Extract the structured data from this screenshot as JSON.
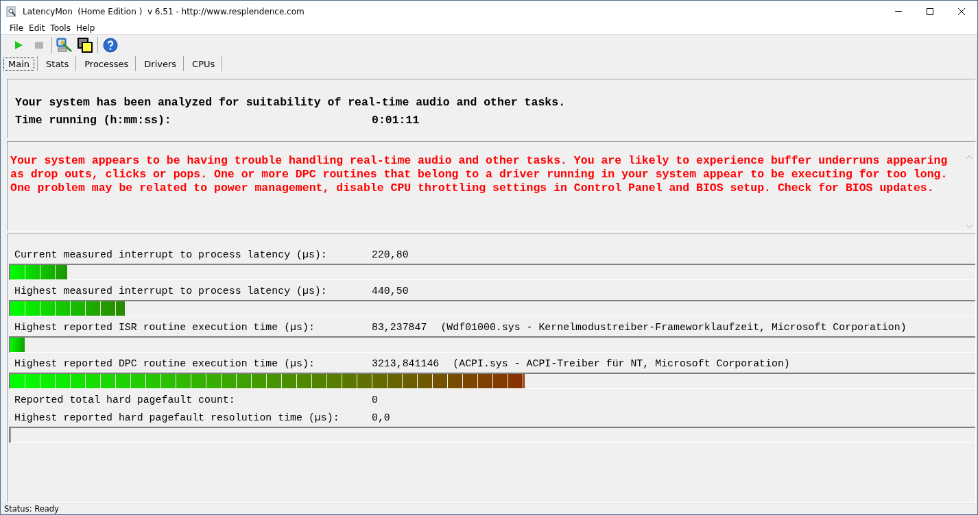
{
  "window": {
    "title": "LatencyMon  (Home Edition )  v 6.51 - http://www.resplendence.com"
  },
  "menu": [
    "File",
    "Edit",
    "Tools",
    "Help"
  ],
  "toolbar": [
    {
      "kind": "start",
      "disabled": false
    },
    {
      "kind": "stop",
      "disabled": true
    },
    {
      "kind": "separator"
    },
    {
      "kind": "monitor"
    },
    {
      "kind": "windows"
    },
    {
      "kind": "separator"
    },
    {
      "kind": "help"
    }
  ],
  "tabs": [
    {
      "label": "Main",
      "selected": true
    },
    {
      "label": "Stats",
      "selected": false
    },
    {
      "label": "Processes",
      "selected": false
    },
    {
      "label": "Drivers",
      "selected": false
    },
    {
      "label": "CPUs",
      "selected": false
    }
  ],
  "summary": {
    "text": "Your system has been analyzed for suitability of real-time audio and other tasks.",
    "time_label": "Time running (h:mm:ss):",
    "time_value": "0:01:11"
  },
  "verdict": {
    "text": "Your system appears to be having trouble handling real-time audio and other tasks. You are likely to experience buffer underruns appearing as drop outs, clicks or pops. One or more DPC routines that belong to a driver running in your system appear to be executing for too long. One problem may be related to power management, disable CPU throttling settings in Control Panel and BIOS setup. Check for BIOS updates."
  },
  "measurements": [
    {
      "kind": "meter",
      "label": "Current measured interrupt to process latency (µs):",
      "value": "220,80",
      "level": 0.059
    },
    {
      "kind": "meter",
      "label": "Highest measured interrupt to process latency (µs):",
      "value": "440,50",
      "level": 0.119
    },
    {
      "kind": "meter",
      "label": "Highest reported ISR routine execution time (µs):",
      "value": "83,237847",
      "detail": "(Wdf01000.sys - Kernelmodustreiber-Frameworklaufzeit, Microsoft Corporation)",
      "level": 0.015
    },
    {
      "kind": "meter",
      "label": "Highest reported DPC routine execution time (µs):",
      "value": "3213,841146",
      "detail": "(ACPI.sys - ACPI-Treiber für NT, Microsoft Corporation)",
      "level": 0.533
    },
    {
      "kind": "plain",
      "label": "Reported total hard pagefault count:",
      "value": "0"
    },
    {
      "kind": "meter",
      "label": "Highest reported hard pagefault resolution time (µs):",
      "value": "0,0",
      "level": 0
    }
  ],
  "status_bar": "Status: Ready"
}
